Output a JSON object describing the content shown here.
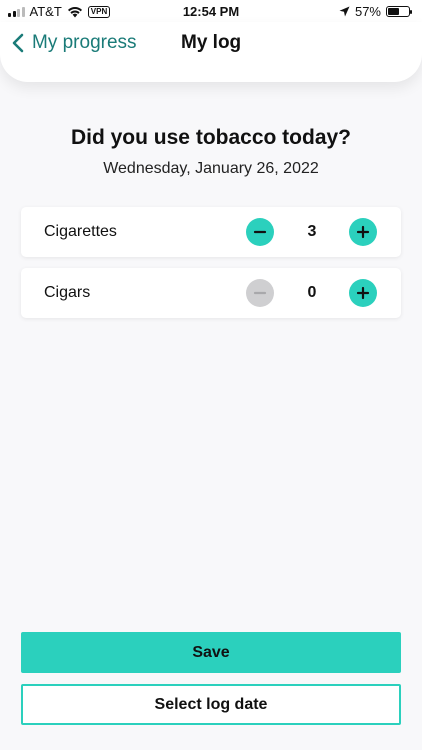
{
  "status_bar": {
    "carrier": "AT&T",
    "vpn": "VPN",
    "time": "12:54 PM",
    "battery_percent": "57%",
    "battery_level": 0.57
  },
  "nav": {
    "back_label": "My progress",
    "title": "My log"
  },
  "main": {
    "question": "Did you use tobacco today?",
    "date": "Wednesday, January 26, 2022",
    "items": [
      {
        "label": "Cigarettes",
        "count": "3",
        "minus_enabled": true
      },
      {
        "label": "Cigars",
        "count": "0",
        "minus_enabled": false
      }
    ]
  },
  "actions": {
    "save_label": "Save",
    "select_date_label": "Select log date"
  },
  "colors": {
    "accent": "#2bd0bd",
    "back_link": "#1a7b78",
    "disabled": "#cfcfd1"
  }
}
